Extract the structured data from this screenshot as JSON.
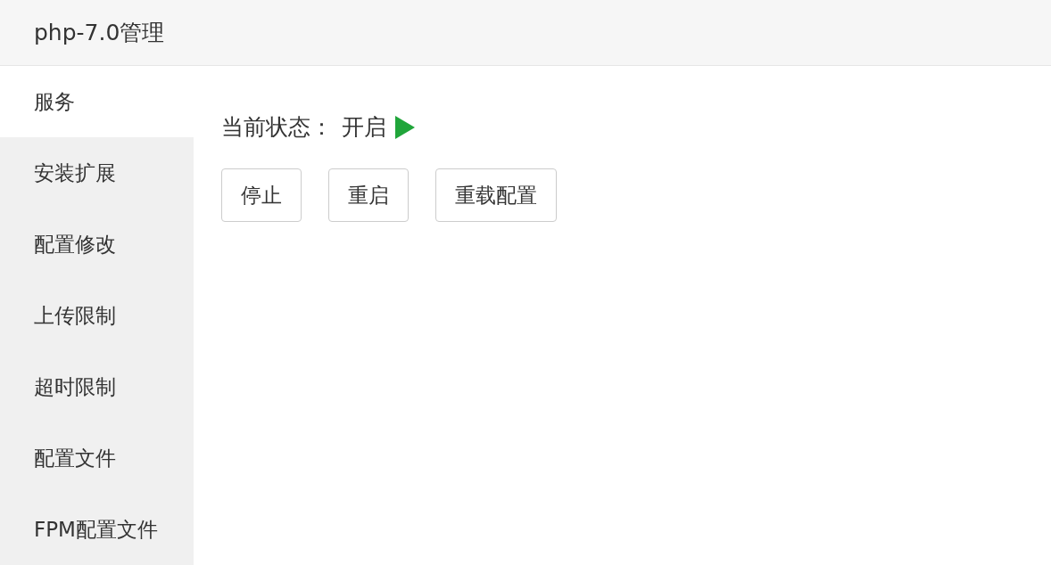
{
  "window": {
    "title": "php-7.0管理"
  },
  "sidebar": {
    "items": [
      {
        "label": "服务",
        "selected": true
      },
      {
        "label": "安装扩展",
        "selected": false
      },
      {
        "label": "配置修改",
        "selected": false
      },
      {
        "label": "上传限制",
        "selected": false
      },
      {
        "label": "超时限制",
        "selected": false
      },
      {
        "label": "配置文件",
        "selected": false
      },
      {
        "label": "FPM配置文件",
        "selected": false
      }
    ]
  },
  "status": {
    "label": "当前状态：",
    "value": "开启",
    "running": true
  },
  "buttons": [
    "停止",
    "重启",
    "重载配置"
  ]
}
